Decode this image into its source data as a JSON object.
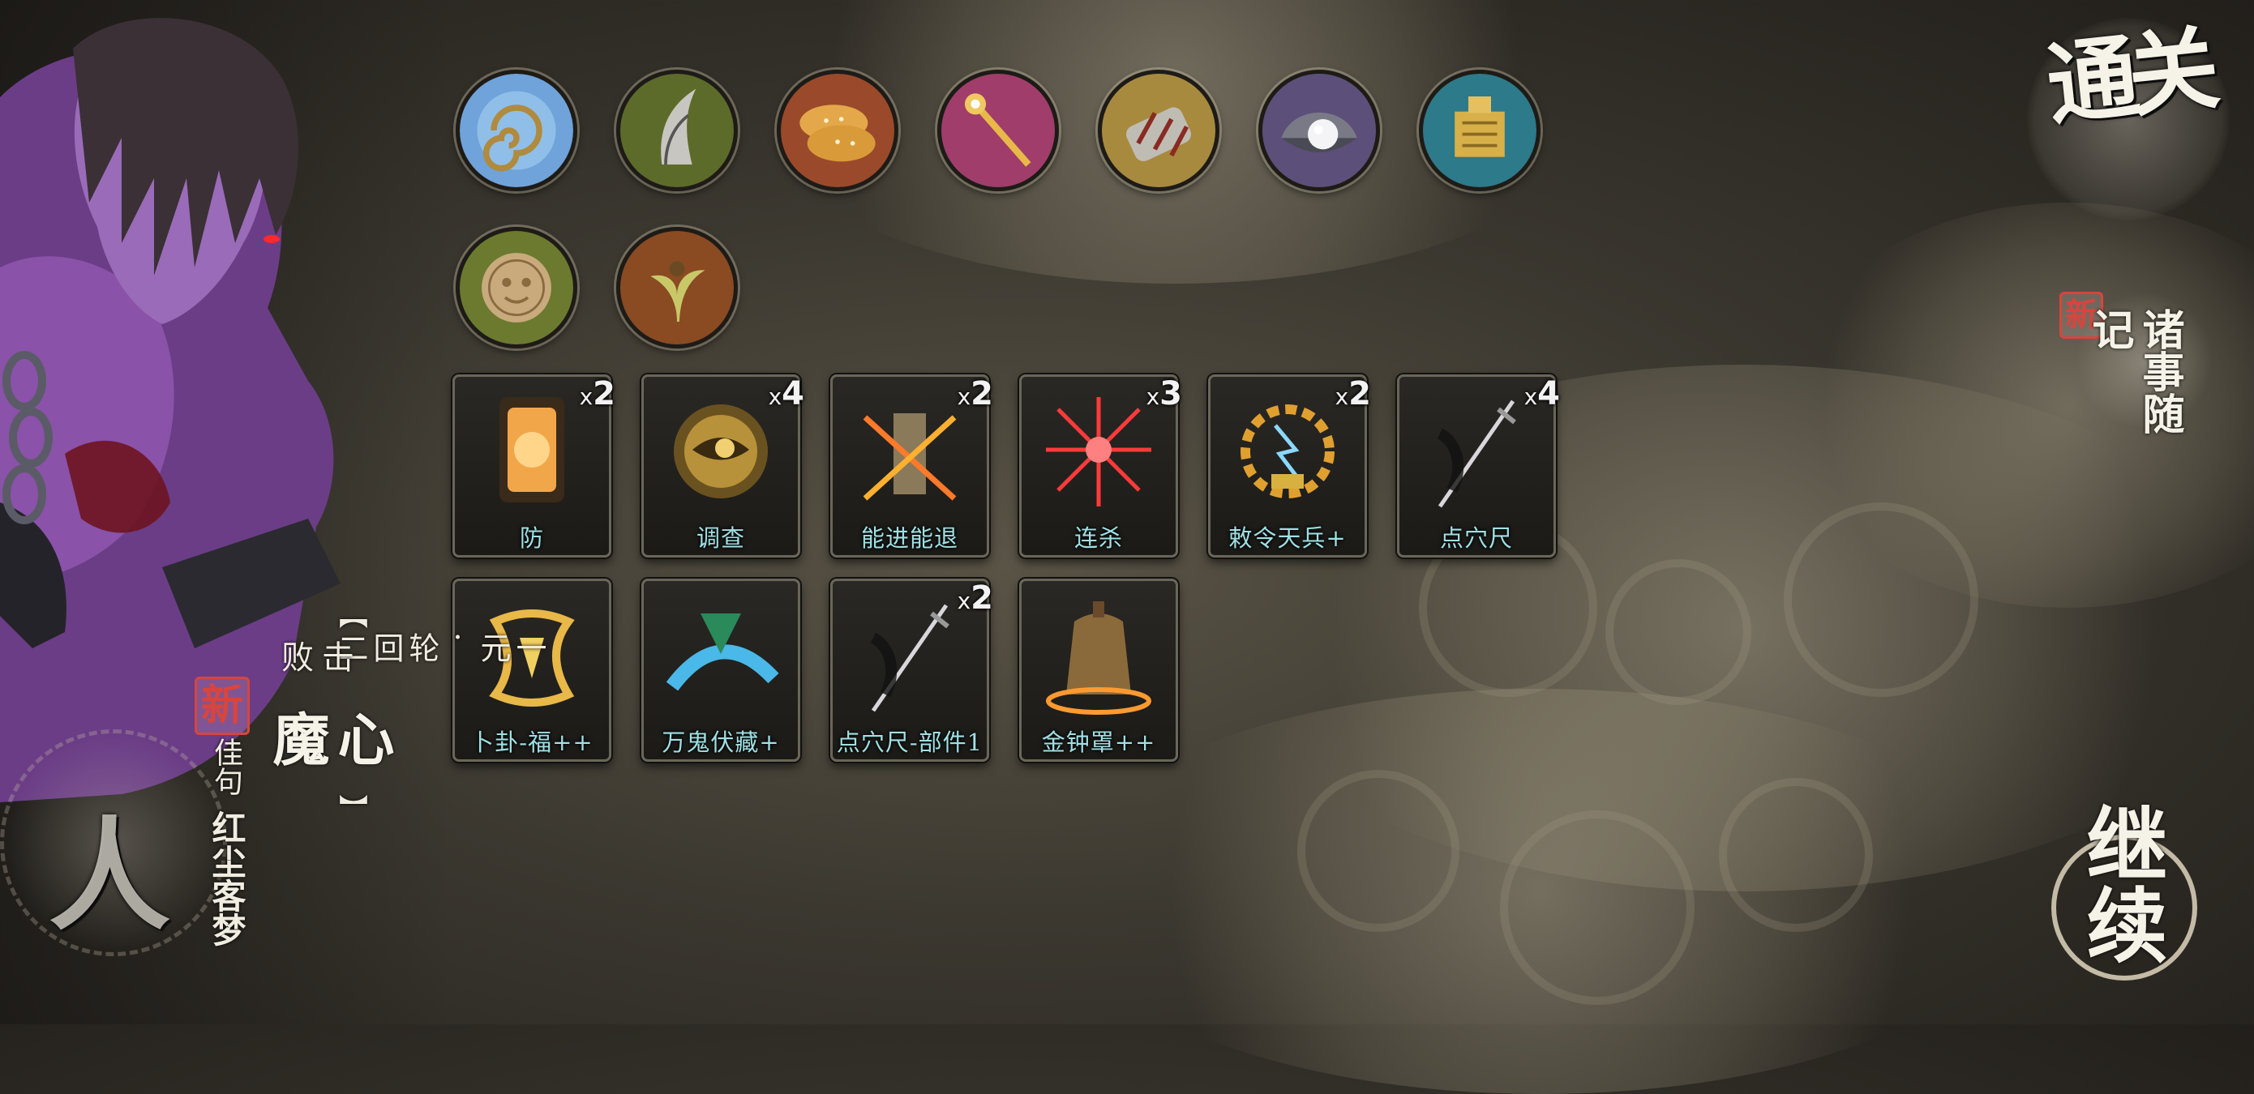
{
  "relics": [
    {
      "icon": "spiral-orb-icon",
      "color": "#6fa3d9"
    },
    {
      "icon": "claw-icon",
      "color": "#5d6b2a"
    },
    {
      "icon": "flatbread-icon",
      "color": "#9a4a2a"
    },
    {
      "icon": "golden-staff-icon",
      "color": "#a03d6a"
    },
    {
      "icon": "armored-gauntlet-icon",
      "color": "#a78a3e"
    },
    {
      "icon": "pearl-shell-icon",
      "color": "#5c4f7a"
    },
    {
      "icon": "golden-seal-icon",
      "color": "#2d7a8a"
    },
    {
      "icon": "bronze-coin-icon",
      "color": "#6b7a2e"
    },
    {
      "icon": "sprout-icon",
      "color": "#8a4a22"
    }
  ],
  "cards": [
    {
      "name": "防",
      "count": "2",
      "icon": "lantern-shield-icon"
    },
    {
      "name": "调查",
      "count": "4",
      "icon": "eye-orb-icon"
    },
    {
      "name": "能进能退",
      "count": "2",
      "icon": "crossed-banner-icon"
    },
    {
      "name": "连杀",
      "count": "3",
      "icon": "red-slash-icon"
    },
    {
      "name": "敕令天兵+",
      "count": "2",
      "icon": "lightning-seal-icon"
    },
    {
      "name": "点穴尺",
      "count": "4",
      "icon": "sword-icon"
    },
    {
      "name": "卜卦-福++",
      "count": "",
      "icon": "golden-glyph-icon"
    },
    {
      "name": "万鬼伏藏+",
      "count": "",
      "icon": "ghost-arc-icon"
    },
    {
      "name": "点穴尺-部件1",
      "count": "2",
      "icon": "sword-icon"
    },
    {
      "name": "金钟罩++",
      "count": "",
      "icon": "golden-bell-icon"
    }
  ],
  "count_prefix": "x",
  "right": {
    "clear_title": "通关",
    "notes_new": "新",
    "notes_title": "诸事随记",
    "continue": "继续"
  },
  "chapter": {
    "bracket_top": "【",
    "tag": "一元·轮回二",
    "bracket_bottom": "】",
    "mode": "击败",
    "boss": "心魔"
  },
  "bottom_left": {
    "new_stamp": "新",
    "label": "佳句",
    "text": "红尘客梦",
    "seal_glyph": "人"
  }
}
